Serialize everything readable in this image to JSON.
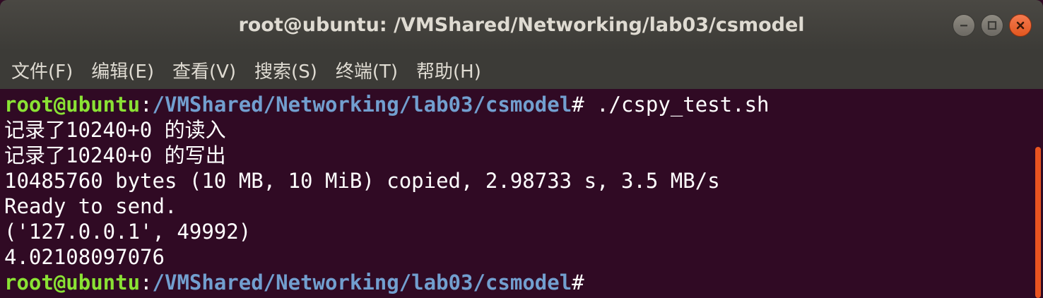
{
  "window": {
    "title": "root@ubuntu: /VMShared/Networking/lab03/csmodel"
  },
  "menu": {
    "items": [
      {
        "label": "文件(F)"
      },
      {
        "label": "编辑(E)"
      },
      {
        "label": "查看(V)"
      },
      {
        "label": "搜索(S)"
      },
      {
        "label": "终端(T)"
      },
      {
        "label": "帮助(H)"
      }
    ]
  },
  "terminal": {
    "prompt": {
      "user": "root@ubuntu",
      "colon": ":",
      "path": "/VMShared/Networking/lab03/csmodel",
      "hash": "#"
    },
    "command": " ./cspy_test.sh",
    "output": [
      "记录了10240+0 的读入",
      "记录了10240+0 的写出",
      "10485760 bytes (10 MB, 10 MiB) copied, 2.98733 s, 3.5 MB/s",
      "Ready to send.",
      "('127.0.0.1', 49992)",
      "4.02108097076"
    ]
  },
  "icons": [
    "minimize-icon",
    "maximize-icon",
    "close-icon"
  ],
  "colors": {
    "background": "#300a24",
    "prompt_user": "#8ae234",
    "prompt_path": "#729fcf",
    "titlebar": "#3c3b37",
    "close_button": "#e95420"
  }
}
